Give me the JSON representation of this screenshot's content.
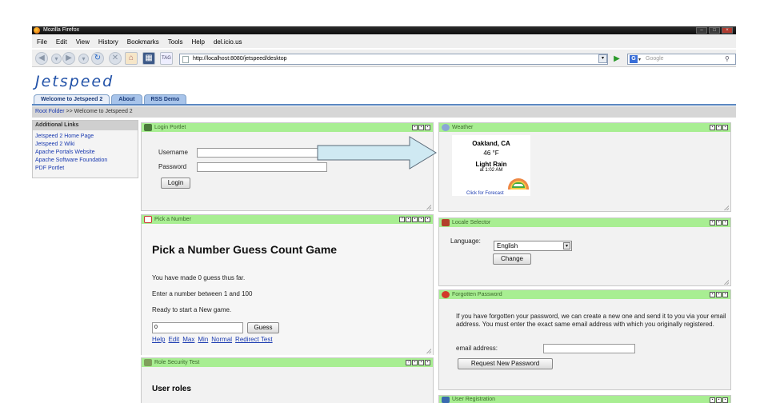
{
  "browser": {
    "title": "Mozilla Firefox",
    "menu": [
      "File",
      "Edit",
      "View",
      "History",
      "Bookmarks",
      "Tools",
      "Help",
      "del.icio.us"
    ],
    "url": "http://localhost:8080/jetspeed/desktop",
    "search_placeholder": "Google"
  },
  "site": {
    "logo": "Jetspeed",
    "tabs": [
      "Welcome to Jetspeed 2",
      "About",
      "RSS Demo"
    ],
    "breadcrumb_root": "Root Folder",
    "breadcrumb_sep": ">>",
    "breadcrumb_current": "Welcome to Jetspeed 2"
  },
  "sidebar": {
    "header": "Additional Links",
    "items": [
      "Jetspeed 2 Home Page",
      "Jetspeed 2 Wiki",
      "Apache Portals Website",
      "Apache Software Foundation",
      "PDF Portlet"
    ]
  },
  "login": {
    "title": "Login Portlet",
    "username_label": "Username",
    "password_label": "Password",
    "button": "Login"
  },
  "weather": {
    "title": "Weather",
    "city": "Oakland, CA",
    "temp": "46 °F",
    "condition": "Light Rain",
    "time": "at 1:02 AM",
    "forecast_link": "Click for Forecast"
  },
  "pick_number": {
    "title": "Pick a Number",
    "heading": "Pick a Number Guess Count Game",
    "line1": "You have made 0 guess thus far.",
    "line2": "Enter a number between 1 and 100",
    "line3": "Ready to start a New game.",
    "input_value": "0",
    "guess_button": "Guess",
    "links": [
      "Help",
      "Edit",
      "Max",
      "Min",
      "Normal",
      "Redirect Test"
    ]
  },
  "locale": {
    "title": "Locale Selector",
    "language_label": "Language:",
    "selected": "English",
    "change_button": "Change"
  },
  "forgot": {
    "title": "Forgotten Password",
    "text": "If you have forgotten your password, we can create a new one and send it to you via your email address. You must enter the exact same email address with which you originally registered.",
    "email_label": "email address:",
    "button": "Request New Password"
  },
  "role": {
    "title": "Role Security Test",
    "heading": "User roles"
  },
  "registration": {
    "title": "User Registration"
  },
  "colors": {
    "portlet_header": "#a8ee92",
    "link": "#1a3ab0",
    "logo": "#2252a8"
  }
}
